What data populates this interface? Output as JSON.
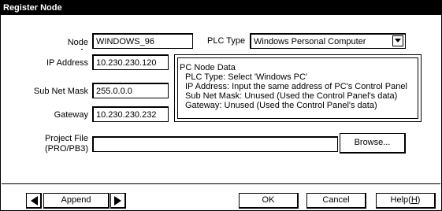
{
  "window": {
    "title": "Register Node"
  },
  "form": {
    "node_label": "Node",
    "node_value": "WINDOWS_96",
    "plc_type_label": "PLC Type",
    "plc_type_value": "Windows Personal Computer",
    "ip_label": "IP Address",
    "ip_value": "10.230.230.120",
    "subnet_label": "Sub Net Mask",
    "subnet_value": "255.0.0.0",
    "gateway_label": "Gateway",
    "gateway_value": "10.230.230.232",
    "project_file_label_1": "Project File",
    "project_file_label_2": "(PRO/PB3)",
    "project_file_value": "",
    "browse_label": "Browse..."
  },
  "info": {
    "heading": "PC Node Data",
    "lines": [
      "PLC Type: Select 'Windows PC'",
      "IP Address: Input the same address of PC's Control Panel",
      "Sub Net Mask: Unused (Used the Control Panel's data)",
      "Gateway: Unused (Used the Control Panel's data)"
    ]
  },
  "footer": {
    "append_label": "Append",
    "ok_label": "OK",
    "cancel_label": "Cancel",
    "help_label": "Help(",
    "help_accel": "H",
    "help_close": ")"
  },
  "icons": {
    "prev": "triangle-left-icon",
    "next": "triangle-right-icon",
    "dropdown": "triangle-down-icon"
  }
}
